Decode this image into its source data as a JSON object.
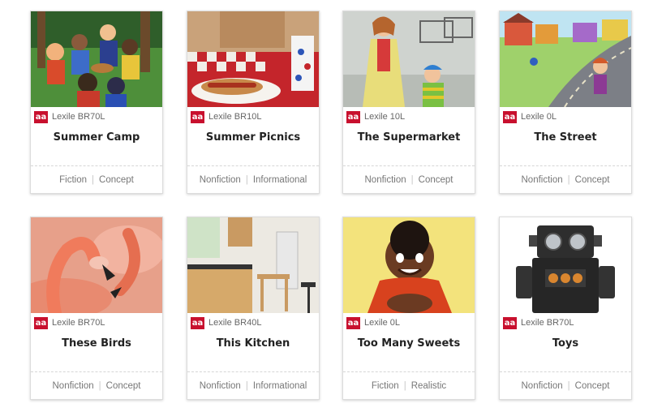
{
  "badge_label": "aa",
  "badge_color": "#c8102e",
  "books": [
    {
      "title": "Summer Camp",
      "lexile": "Lexile BR70L",
      "genre": "Fiction",
      "type": "Concept"
    },
    {
      "title": "Summer Picnics",
      "lexile": "Lexile BR10L",
      "genre": "Nonfiction",
      "type": "Informational"
    },
    {
      "title": "The Supermarket",
      "lexile": "Lexile 10L",
      "genre": "Nonfiction",
      "type": "Concept"
    },
    {
      "title": "The Street",
      "lexile": "Lexile 0L",
      "genre": "Nonfiction",
      "type": "Concept"
    },
    {
      "title": "These Birds",
      "lexile": "Lexile BR70L",
      "genre": "Nonfiction",
      "type": "Concept"
    },
    {
      "title": "This Kitchen",
      "lexile": "Lexile BR40L",
      "genre": "Nonfiction",
      "type": "Informational"
    },
    {
      "title": "Too Many Sweets",
      "lexile": "Lexile 0L",
      "genre": "Fiction",
      "type": "Realistic"
    },
    {
      "title": "Toys",
      "lexile": "Lexile BR70L",
      "genre": "Nonfiction",
      "type": "Concept"
    }
  ]
}
